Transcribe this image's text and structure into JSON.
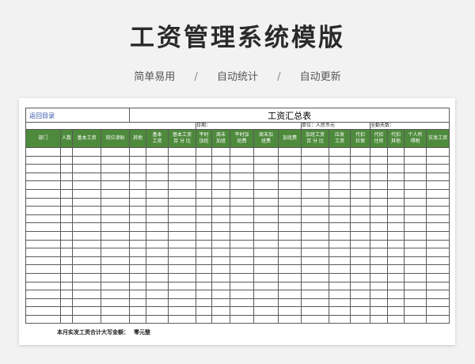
{
  "banner": {
    "title": "工资管理系统模版",
    "features": [
      "简单易用",
      "自动统计",
      "自动更新"
    ],
    "separator": "/"
  },
  "sheet": {
    "back_link": "返回目录",
    "title": "工资汇总表",
    "date_label": "日期：",
    "unit_label": "单位：人民币元",
    "attendance_label": "全勤天数：",
    "columns": [
      "部门",
      "人数",
      "基本工资",
      "岗位津贴",
      "其他",
      "基本\n工资",
      "基本工资\n百 分 比",
      "平时\n加班",
      "周末\n加班",
      "平时加\n班费",
      "周末加\n班费",
      "加班费",
      "加班工资\n百 分 比",
      "应发\n工资",
      "代扣\n社保",
      "代扣\n住房",
      "代扣\n其他",
      "个人所\n得税",
      "实发工资"
    ],
    "empty_row_count": 21,
    "footer_label": "本月实发工资合计大写金额：",
    "footer_amount": "零元整",
    "header_color": "#4e8a3c"
  }
}
